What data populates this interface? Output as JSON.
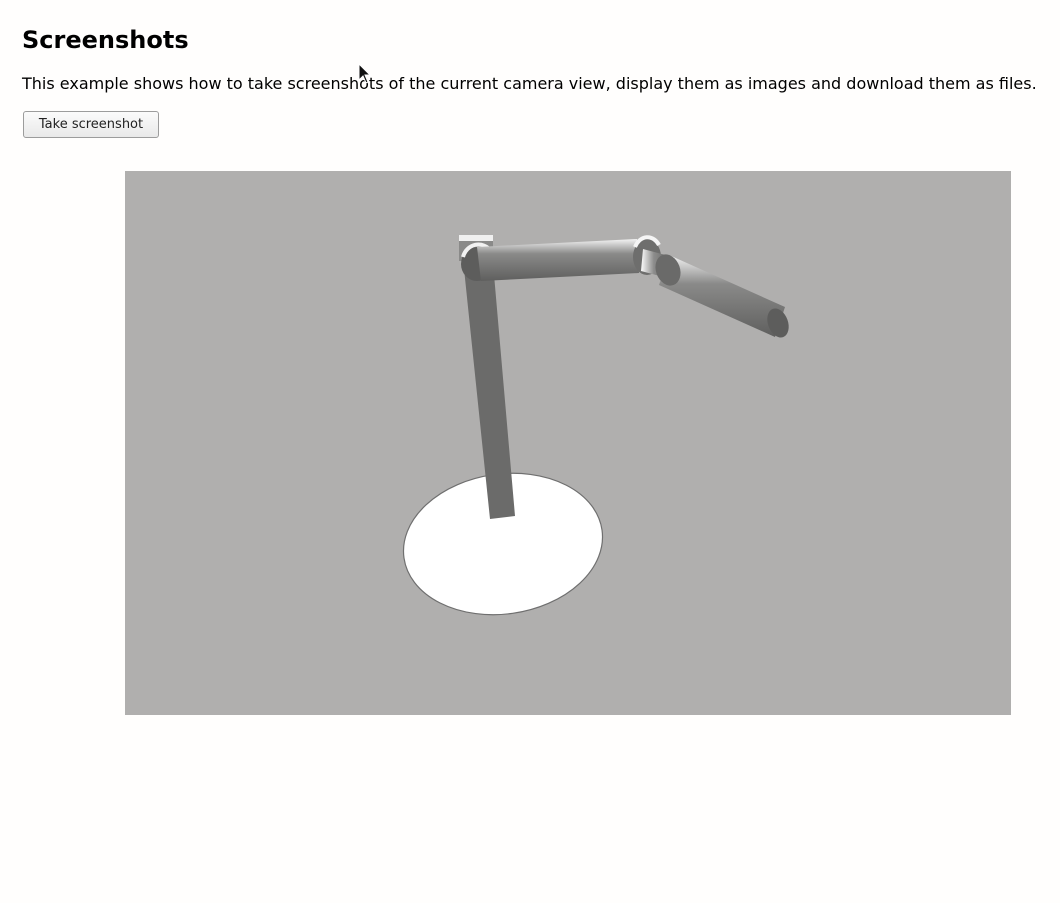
{
  "page": {
    "title": "Screenshots",
    "description": "This example shows how to take screenshots of the current camera view, display them as images and download them as files."
  },
  "controls": {
    "take_screenshot_label": "Take screenshot"
  },
  "scene": {
    "background_color": "#b0afae",
    "base_color": "#ffffff",
    "arm_color": "#6b6b6a"
  }
}
